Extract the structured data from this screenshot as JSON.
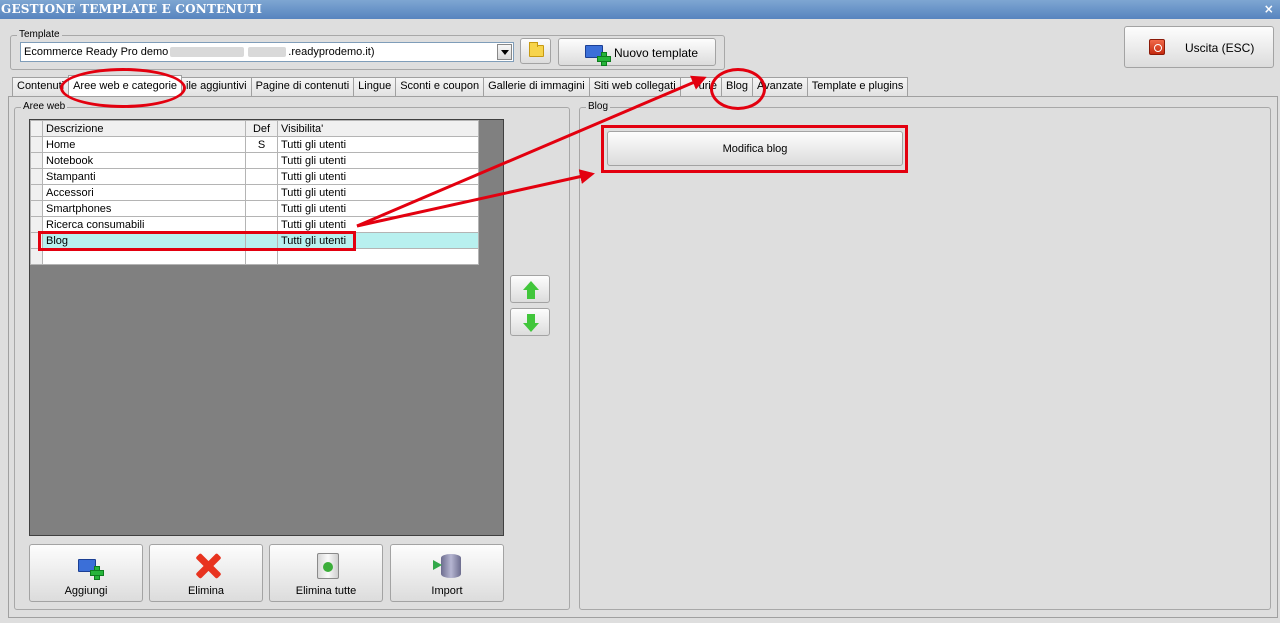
{
  "window": {
    "title": "GESTIONE TEMPLATE E CONTENUTI",
    "close_glyph": "×"
  },
  "template_group": {
    "label": "Template",
    "select_value_prefix": "Ecommerce Ready Pro demo",
    "select_value_suffix": ".readyprodemo.it)"
  },
  "buttons": {
    "nuovo_template": "Nuovo template",
    "uscita": "Uscita (ESC)"
  },
  "tabs": [
    {
      "label": "Contenuti"
    },
    {
      "label": "Aree web e categorie",
      "active": true
    },
    {
      "label": "ile aggiuntivi"
    },
    {
      "label": "Pagine di contenuti"
    },
    {
      "label": "Lingue"
    },
    {
      "label": "Sconti e coupon"
    },
    {
      "label": "Gallerie di immagini"
    },
    {
      "label": "Siti web collegati"
    },
    {
      "label": "urie"
    },
    {
      "label": "Blog"
    },
    {
      "label": "Avanzate"
    },
    {
      "label": "Template e plugins"
    }
  ],
  "aree_web": {
    "label": "Aree web",
    "columns": [
      "Descrizione",
      "Def",
      "Visibilita'"
    ],
    "rows": [
      {
        "desc": "Home",
        "def": "S",
        "vis": "Tutti gli utenti"
      },
      {
        "desc": "Notebook",
        "def": "",
        "vis": "Tutti gli utenti"
      },
      {
        "desc": "Stampanti",
        "def": "",
        "vis": "Tutti gli utenti"
      },
      {
        "desc": "Accessori",
        "def": "",
        "vis": "Tutti gli utenti"
      },
      {
        "desc": "Smartphones",
        "def": "",
        "vis": "Tutti gli utenti"
      },
      {
        "desc": "Ricerca consumabili",
        "def": "",
        "vis": "Tutti gli utenti"
      },
      {
        "desc": "Blog",
        "def": "",
        "vis": "Tutti gli utenti",
        "selected": true
      },
      {
        "desc": "",
        "def": "",
        "vis": ""
      }
    ]
  },
  "bottom_buttons": {
    "aggiungi": "Aggiungi",
    "elimina": "Elimina",
    "elimina_tutte": "Elimina tutte",
    "import": "Import"
  },
  "blog_group": {
    "label": "Blog",
    "modifica_blog": "Modifica blog"
  },
  "colors": {
    "title_bar": "#5784bf",
    "selected_row": "#b8f0ef",
    "annotation_red": "#e3000f",
    "grid_background": "#808080"
  }
}
